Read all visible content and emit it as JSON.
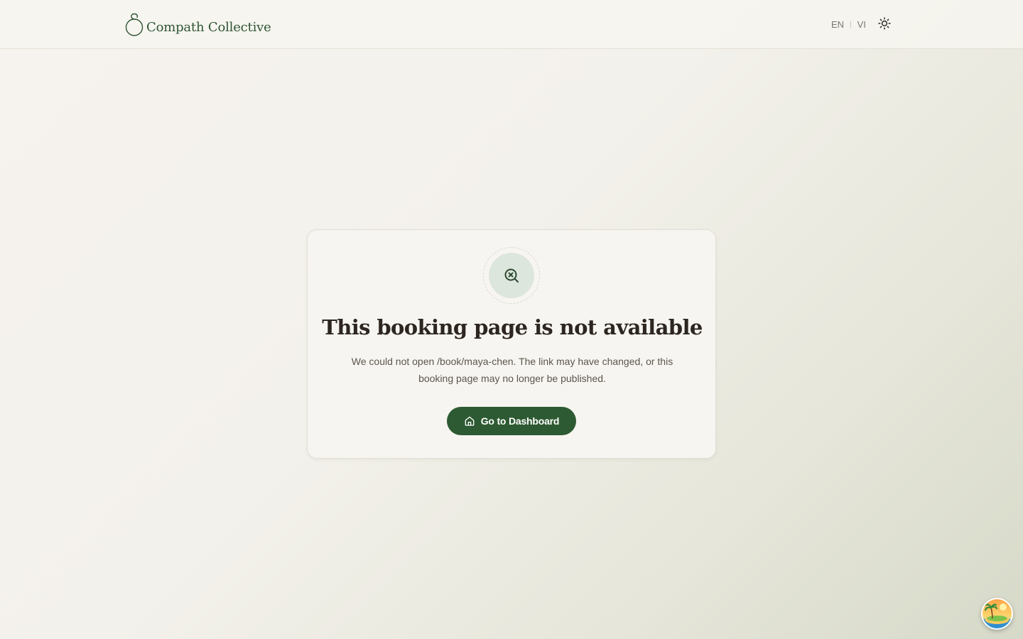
{
  "header": {
    "brand_name": "Compath Collective",
    "languages": [
      "EN",
      "VI"
    ],
    "language_separator": "|",
    "theme_icon": "sun-icon"
  },
  "not_found": {
    "icon": "search-x-icon",
    "title": "This booking page is not available",
    "description": "We could not open /book/maya-chen. The link may have changed, or this booking page may no longer be published.",
    "button_label": "Go to Dashboard",
    "button_icon": "home-icon"
  },
  "floating_widget": {
    "icon": "island-avatar-icon"
  },
  "colors": {
    "brand_green": "#2d5a32",
    "icon_circle_bg": "#dde6dc",
    "page_bg": "#f4f1ec"
  }
}
